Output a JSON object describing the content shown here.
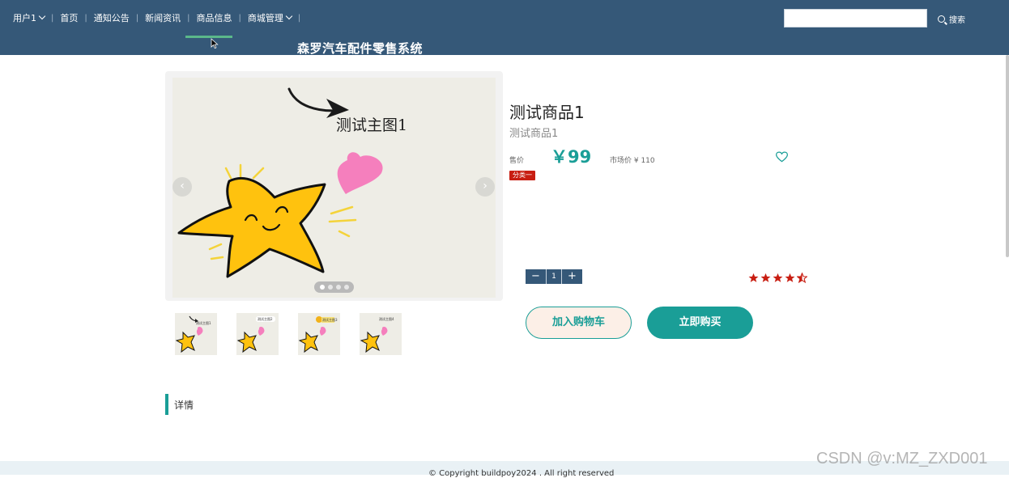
{
  "nav": {
    "user": "用户1",
    "items": [
      "首页",
      "通知公告",
      "新闻资讯",
      "商品信息",
      "商城管理"
    ],
    "active_index": 3
  },
  "site_title": "森罗汽车配件零售系统",
  "search": {
    "placeholder": "",
    "button": "搜索"
  },
  "gallery": {
    "main_caption": "测试主图1",
    "thumb_captions": [
      "测试主图1",
      "测试主图2",
      "测试主图3",
      "测试主图4"
    ],
    "slide_count": 4,
    "active_slide": 0
  },
  "product": {
    "title": "测试商品1",
    "subtitle": "测试商品1",
    "price_label": "售价",
    "price": "￥99",
    "market_price": "市场价 ¥ 110",
    "category": "分类一",
    "quantity": "1",
    "rating": 4.5
  },
  "buttons": {
    "add_cart": "加入购物车",
    "buy_now": "立即购买"
  },
  "details": {
    "title": "详情"
  },
  "footer": {
    "text": "© Copyright buildpoy2024 . All right reserved"
  },
  "watermark": "CSDN @v:MZ_ZXD001",
  "colors": {
    "nav_bg": "#355878",
    "accent": "#1a9e97",
    "badge": "#c81e12",
    "star": "#c81e12"
  },
  "icons": [
    "chevron-down-icon",
    "search-icon",
    "heart-outline-icon",
    "chevron-left-icon",
    "chevron-right-icon",
    "star-icon",
    "minus-icon",
    "plus-icon"
  ]
}
